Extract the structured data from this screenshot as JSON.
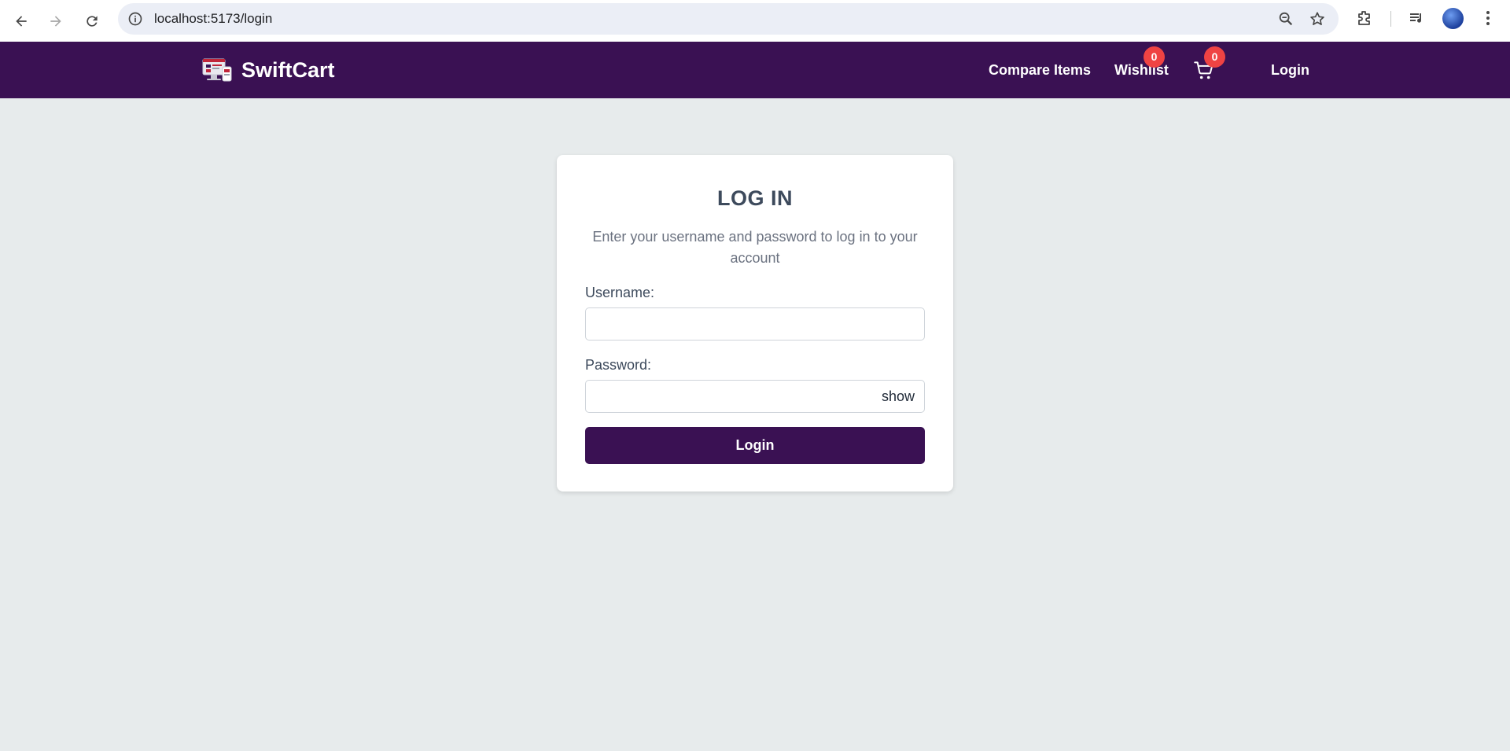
{
  "browser": {
    "url": "localhost:5173/login"
  },
  "header": {
    "brand_name": "SwiftCart",
    "compare_label": "Compare Items",
    "wishlist_label": "Wishlist",
    "wishlist_count": "0",
    "cart_count": "0",
    "login_label": "Login"
  },
  "login_card": {
    "title": "LOG IN",
    "subtitle": "Enter your username and password to log in to your account",
    "username_label": "Username:",
    "username_value": "",
    "password_label": "Password:",
    "password_value": "",
    "show_label": "show",
    "submit_label": "Login"
  },
  "colors": {
    "brand_purple": "#3a1153",
    "badge_red": "#ef4343",
    "page_background": "#e7ebec"
  },
  "icons": [
    "back-arrow-icon",
    "forward-arrow-icon",
    "reload-icon",
    "site-info-icon",
    "zoom-icon",
    "bookmark-star-icon",
    "extensions-icon",
    "media-queue-icon",
    "profile-avatar",
    "more-menu-icon",
    "brand-logo-icon",
    "cart-icon"
  ]
}
